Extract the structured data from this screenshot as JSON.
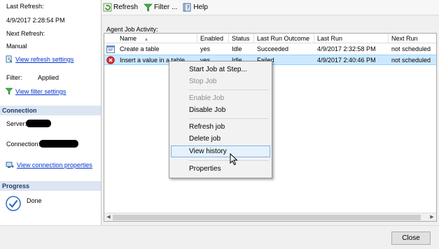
{
  "left": {
    "last_refresh_label": "Last Refresh:",
    "last_refresh_value": "4/9/2017 2:28:54 PM",
    "next_refresh_label": "Next Refresh:",
    "next_refresh_value": "Manual",
    "view_refresh_settings": "View refresh settings",
    "filter_label": "Filter:",
    "filter_value": "Applied",
    "view_filter_settings": "View filter settings",
    "connection_header": "Connection",
    "server_label": "Server:",
    "connection_label": "Connection:",
    "view_connection_properties": "View connection properties",
    "progress_header": "Progress",
    "progress_status": "Done"
  },
  "toolbar": {
    "refresh": "Refresh",
    "filter": "Filter ...",
    "help": "Help"
  },
  "grid": {
    "label": "Agent Job Activity:",
    "columns": [
      "Name",
      "Enabled",
      "Status",
      "Last Run Outcome",
      "Last Run",
      "Next Run"
    ],
    "rows": [
      {
        "name": "Create a table",
        "enabled": "yes",
        "status": "Idle",
        "outcome": "Succeeded",
        "last_run": "4/9/2017 2:32:58 PM",
        "next_run": "not scheduled",
        "icon": "job-success-icon"
      },
      {
        "name": "Insert a value in a table",
        "enabled": "yes",
        "status": "Idle",
        "outcome": "Failed",
        "last_run": "4/9/2017 2:40:46 PM",
        "next_run": "not scheduled",
        "icon": "job-failed-icon"
      }
    ]
  },
  "context_menu": {
    "start_job_at_step": "Start Job at Step...",
    "stop_job": "Stop Job",
    "enable_job": "Enable Job",
    "disable_job": "Disable Job",
    "refresh_job": "Refresh job",
    "delete_job": "Delete job",
    "view_history": "View history",
    "properties": "Properties"
  },
  "footer": {
    "close": "Close"
  },
  "colors": {
    "link": "#0033cc",
    "section_header_bg": "#dce6f2",
    "selection_bg": "#cce8ff",
    "menu_hover_bg": "#e5f1fb"
  }
}
